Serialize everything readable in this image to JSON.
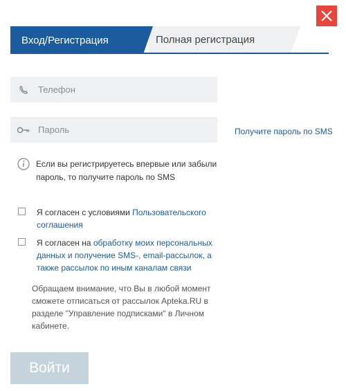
{
  "close_button": {
    "icon": "close-icon",
    "color": "#e8453c"
  },
  "tabs": [
    {
      "label": "Вход/Регистрация",
      "active": true
    },
    {
      "label": "Полная регистрация",
      "active": false
    }
  ],
  "form": {
    "phone": {
      "placeholder": "Телефон",
      "value": "",
      "icon": "phone-icon"
    },
    "password": {
      "placeholder": "Пароль",
      "value": "",
      "icon": "key-icon"
    },
    "sms_link": "Получите пароль по SMS"
  },
  "info": {
    "icon": "info-icon",
    "text": "Если вы регистрируетесь впервые или забыли пароль, то получите пароль по SMS"
  },
  "consents": [
    {
      "prefix": "Я согласен с условиями ",
      "link": "Пользовательского соглашения",
      "checked": false
    },
    {
      "prefix": "Я согласен на ",
      "link": "обработку моих персональных данных и получение SMS-, email-рассылок, а также рассылок по иным каналам связи",
      "checked": false
    }
  ],
  "note": "Обращаем внимание, что Вы в любой момент сможете отписаться от рассылок Apteka.RU в разделе \"Управление подписками\" в Личном кабинете.",
  "login_button": {
    "label": "Войти"
  },
  "colors": {
    "accent": "#1a5c9e",
    "field_bg": "#eef0f2",
    "button_disabled": "#c4d3dc"
  }
}
